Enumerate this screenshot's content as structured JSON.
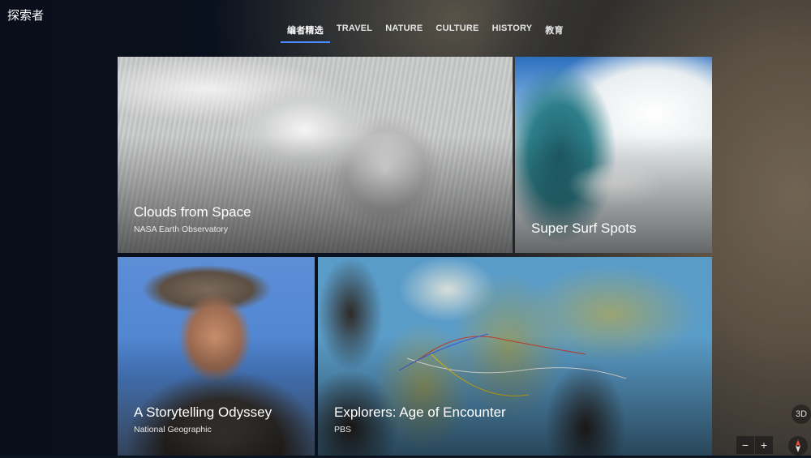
{
  "app": {
    "title": "探索者"
  },
  "tabs": [
    {
      "label": "编者精选",
      "active": true
    },
    {
      "label": "TRAVEL",
      "active": false
    },
    {
      "label": "NATURE",
      "active": false
    },
    {
      "label": "CULTURE",
      "active": false
    },
    {
      "label": "HISTORY",
      "active": false
    },
    {
      "label": "教育",
      "active": false
    }
  ],
  "cards": [
    {
      "title": "Clouds from Space",
      "source": "NASA Earth Observatory"
    },
    {
      "title": "Super Surf Spots"
    },
    {
      "title": "A Storytelling Odyssey",
      "source": "National Geographic"
    },
    {
      "title": "Explorers: Age of Encounter",
      "source": "PBS"
    }
  ],
  "map_controls": {
    "mode_label": "3D",
    "zoom_out": "−",
    "zoom_in": "+"
  },
  "colors": {
    "accent": "#4a8cff",
    "background": "#0c1422"
  }
}
